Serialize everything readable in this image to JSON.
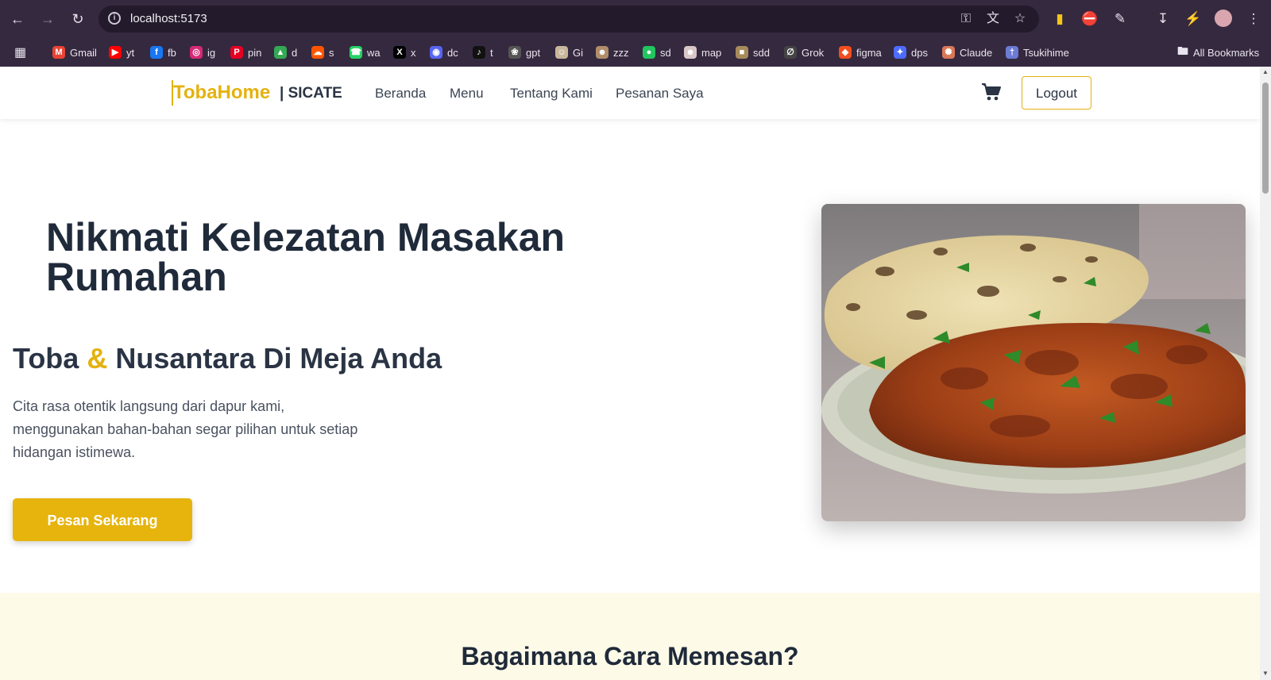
{
  "browser": {
    "url": "localhost:5173",
    "bookmarks": [
      {
        "label": "Gmail",
        "icon": "gmail-icon",
        "color": "#ea4335"
      },
      {
        "label": "yt",
        "icon": "youtube-icon",
        "color": "#ff0000"
      },
      {
        "label": "fb",
        "icon": "facebook-icon",
        "color": "#1877f2"
      },
      {
        "label": "ig",
        "icon": "instagram-icon",
        "color": "#d62976"
      },
      {
        "label": "pin",
        "icon": "pinterest-icon",
        "color": "#e60023"
      },
      {
        "label": "d",
        "icon": "drive-icon",
        "color": "#34a853"
      },
      {
        "label": "s",
        "icon": "soundcloud-icon",
        "color": "#ff5500"
      },
      {
        "label": "wa",
        "icon": "whatsapp-icon",
        "color": "#25d366"
      },
      {
        "label": "x",
        "icon": "x-icon",
        "color": "#000000"
      },
      {
        "label": "dc",
        "icon": "discord-icon",
        "color": "#5865f2"
      },
      {
        "label": "t",
        "icon": "tiktok-icon",
        "color": "#111111"
      },
      {
        "label": "gpt",
        "icon": "chatgpt-icon",
        "color": "#555555"
      },
      {
        "label": "Gi",
        "icon": "gi-icon",
        "color": "#c9b79c"
      },
      {
        "label": "zzz",
        "icon": "zzz-icon",
        "color": "#b08d6a"
      },
      {
        "label": "sd",
        "icon": "sd-icon",
        "color": "#22c55e"
      },
      {
        "label": "map",
        "icon": "map-icon",
        "color": "#d9c7c7"
      },
      {
        "label": "sdd",
        "icon": "sdd-icon",
        "color": "#a78b5a"
      },
      {
        "label": "Grok",
        "icon": "grok-icon",
        "color": "#444444"
      },
      {
        "label": "figma",
        "icon": "figma-icon",
        "color": "#f24e1e"
      },
      {
        "label": "dps",
        "icon": "dps-icon",
        "color": "#4d6bfe"
      },
      {
        "label": "Claude",
        "icon": "claude-icon",
        "color": "#d97757"
      },
      {
        "label": "Tsukihime",
        "icon": "tsukihime-icon",
        "color": "#6b7bd6"
      }
    ],
    "all_bookmarks_label": "All Bookmarks"
  },
  "header": {
    "brand": "TobaHome",
    "brand_sub": "| SICATE",
    "nav": [
      "Beranda",
      "Menu",
      "Tentang Kami",
      "Pesanan Saya"
    ],
    "logout_label": "Logout"
  },
  "hero": {
    "title": "Nikmati Kelezatan Masakan Rumahan",
    "subtitle_part1": "Toba ",
    "subtitle_amp": "&",
    "subtitle_part2": " Nusantara Di Meja Anda",
    "description": "Cita rasa otentik langsung dari dapur kami, menggunakan bahan-bahan segar pilihan untuk setiap hidangan istimewa.",
    "cta_label": "Pesan Sekarang"
  },
  "steps": {
    "title": "Bagaimana Cara Memesan?"
  },
  "colors": {
    "accent": "#e6b40c",
    "text_dark": "#1f2a3a",
    "steps_bg": "#fefae8"
  }
}
